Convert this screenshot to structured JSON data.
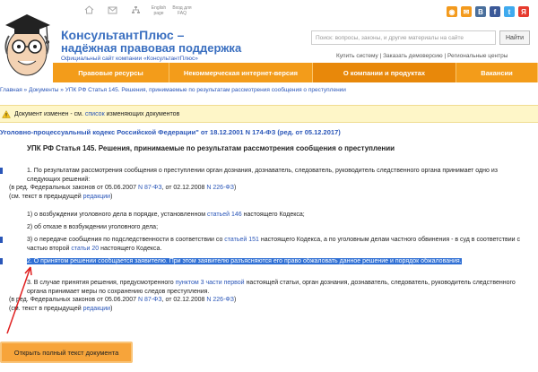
{
  "topbar": {
    "icons": [
      {
        "name": "home-icon",
        "label": ""
      },
      {
        "name": "email-icon",
        "label": ""
      },
      {
        "name": "sitemap-icon",
        "label": ""
      },
      {
        "name": "english-icon",
        "label": "English page"
      },
      {
        "name": "faq-icon",
        "label": "Вход для FAQ"
      }
    ],
    "socials": [
      {
        "name": "rss-icon",
        "glyph": "◉",
        "color": "#f39a1d"
      },
      {
        "name": "mailru-icon",
        "glyph": "✉",
        "color": "#f39a1d"
      },
      {
        "name": "vk-icon",
        "glyph": "B",
        "color": "#4a6f9c"
      },
      {
        "name": "facebook-icon",
        "glyph": "f",
        "color": "#3b5998"
      },
      {
        "name": "twitter-icon",
        "glyph": "t",
        "color": "#3faaee"
      },
      {
        "name": "yandex-icon",
        "glyph": "Я",
        "color": "#e63b2e"
      }
    ]
  },
  "brand": {
    "title1": "КонсультантПлюс –",
    "title2": "надёжная правовая поддержка",
    "subtitle": "Официальный сайт компании «КонсультантПлюс»"
  },
  "search": {
    "placeholder": "Поиск: вопросы, законы, и другие материалы на сайте",
    "button": "Найти"
  },
  "toplinks": "Купить систему | Заказать демоверсию | Региональные центры",
  "nav": [
    {
      "label": "Правовые ресурсы",
      "active": false
    },
    {
      "label": "Некоммерческая интернет-версия",
      "active": false
    },
    {
      "label": "О компании и продуктах",
      "active": true
    },
    {
      "label": "Вакансии",
      "active": false
    }
  ],
  "breadcrumb": "Главная » Документы » УПК РФ Статья 145. Решения, принимаемые по результатам рассмотрения сообщения о преступлении",
  "notice": {
    "text_before": "Документ изменен - см.",
    "link": "список",
    "text_after": "изменяющих документов"
  },
  "codex_title": "Уголовно-процессуальный кодекс Российской Федерации\" от 18.12.2001 N 174-ФЗ (ред. от 05.12.2017)",
  "article_title": "УПК РФ Статья 145. Решения, принимаемые по результатам рассмотрения сообщения о преступлении",
  "paragraphs": {
    "p1_text": "1. По результатам рассмотрения сообщения о преступлении орган дознания, дознаватель, следователь, руководитель следственного органа принимает одно из следующих решений:",
    "p1_amend_a": "(в ред. Федеральных законов от 05.06.2007",
    "p1_amend_link1": "N 87-ФЗ",
    "p1_amend_b": ", от 02.12.2008",
    "p1_amend_link2": "N 226-ФЗ",
    "p1_amend_c": ")",
    "prev_a": "(см. текст в предыдущей",
    "prev_link": "редакции",
    "prev_b": ")",
    "i1_a": "1) о возбуждении уголовного дела в порядке, установленном",
    "i1_link": "статьей 146",
    "i1_b": "настоящего Кодекса;",
    "i2": "2) об отказе в возбуждении уголовного дела;",
    "i3_a": "3) о передаче сообщения по подследственности в соответствии со",
    "i3_link": "статьей 151",
    "i3_b": "настоящего Кодекса, а по уголовным делам частного обвинения - в суд в соответствии с частью второй",
    "i3_link2": "статьи 20",
    "i3_c": "настоящего Кодекса.",
    "p2_highlight": "2. О принятом решении сообщается заявителю. При этом заявителю разъясняются его право обжаловать данное решение и порядок обжалования.",
    "p3_a": "3. В случае принятия решения, предусмотренного",
    "p3_link": "пунктом 3 части первой",
    "p3_b": "настоящей статьи, орган дознания, дознаватель, следователь, руководитель следственного органа принимает меры по сохранению следов преступления.",
    "p3_amend_a": "(в ред. Федеральных законов от 05.06.2007",
    "p3_amend_link1": "N 87-ФЗ",
    "p3_amend_b": ", от 02.12.2008",
    "p3_amend_link2": "N 226-ФЗ",
    "p3_amend_c": ")",
    "prev2_a": "(см. текст в предыдущей",
    "prev2_link": "редакции",
    "prev2_b": ")"
  },
  "open_full_button": "Открыть полный текст документа",
  "colors": {
    "accent": "#f39c1a",
    "link": "#2a56b8",
    "highlight": "#2f6fd4"
  }
}
